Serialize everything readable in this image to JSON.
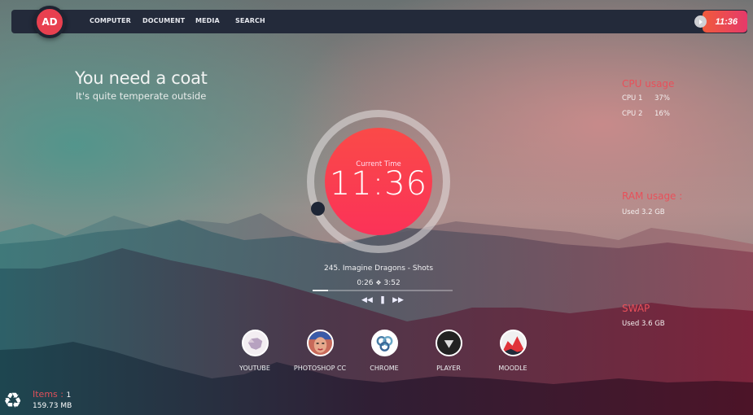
{
  "nav": {
    "logo_text": "AD",
    "items": [
      "COMPUTER",
      "DOCUMENT",
      "MEDIA",
      "SEARCH"
    ],
    "clock": "11:36"
  },
  "weather": {
    "title": "You need a coat",
    "subtitle": "It's quite temperate outside"
  },
  "stats": {
    "cpu": {
      "heading": "CPU usage",
      "rows": [
        {
          "label": "CPU 1",
          "value": "37%"
        },
        {
          "label": "CPU 2",
          "value": "16%"
        }
      ]
    },
    "ram": {
      "heading": "RAM usage :",
      "value": "Used 3.2 GB"
    },
    "swap": {
      "heading": "SWAP",
      "value": "Used 3.6 GB"
    }
  },
  "clock": {
    "label": "Current Time",
    "time": "11:36"
  },
  "player": {
    "track": "245. Imagine Dragons - Shots",
    "elapsed": "0:26",
    "separator": "❖",
    "duration": "3:52",
    "progress_fraction": 0.11,
    "controls": {
      "rewind": "⏪",
      "pause": "❚❚",
      "forward": "⏩"
    }
  },
  "apps": [
    {
      "label": "YOUTUBE",
      "icon": "bear-icon"
    },
    {
      "label": "PHOTOSHOP CC",
      "icon": "portrait-icon"
    },
    {
      "label": "CHROME",
      "icon": "rings-icon"
    },
    {
      "label": "PLAYER",
      "icon": "down-triangle-icon"
    },
    {
      "label": "MOODLE",
      "icon": "chart-icon"
    }
  ],
  "recycle_bin": {
    "items_label": "Items :",
    "items_count": "1",
    "size": "159.73 MB",
    "icon": "♻"
  },
  "colors": {
    "accent": "#fb3a52",
    "nav_bg": "#232a3a",
    "stat_heading": "#e8505a"
  }
}
